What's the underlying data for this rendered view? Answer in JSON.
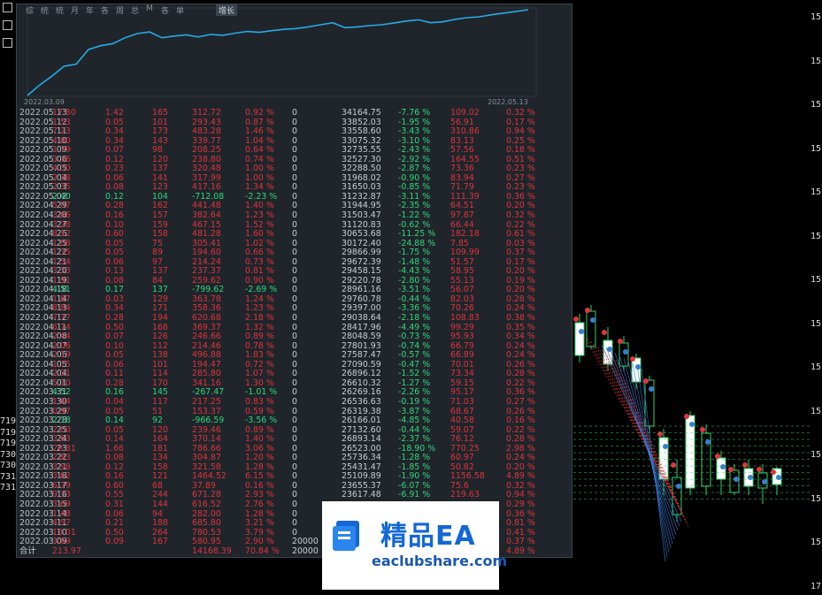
{
  "panel": {
    "tabs": [
      "综",
      "统",
      "统",
      "月",
      "年",
      "各",
      "周",
      "总",
      "M",
      "各",
      "单",
      "增长"
    ],
    "active_tab": "增长",
    "equity_start_label": "2022.03.09",
    "equity_end_label": "2022.05.13",
    "equity_curve": [
      0,
      2.5,
      4.6,
      7,
      7.5,
      11,
      11.9,
      12.4,
      13.8,
      14.8,
      15.2,
      13.8,
      14.2,
      14.5,
      14,
      14.6,
      14.4,
      14.9,
      15.3,
      15.1,
      15.5,
      15.8,
      16,
      16.4,
      16.9,
      17.4,
      16.2,
      16.4,
      16.7,
      16.9,
      17.3,
      17.8,
      18.1,
      17.4,
      17.6,
      18.2,
      18.6,
      18.8,
      19.3,
      19.7,
      20.1,
      20.5
    ],
    "rows": [
      [
        "2022.05.13",
        "17.80",
        "1.42",
        "165",
        "312.72",
        "0.92 %",
        "0",
        "34164.75",
        "-7.76 %",
        "109.02",
        "0.32 %"
      ],
      [
        "2022.05.12",
        "1.53",
        "0.05",
        "101",
        "293.43",
        "0.87 %",
        "0",
        "33852.03",
        "-1.95 %",
        "56.91",
        "0.17 %"
      ],
      [
        "2022.05.11",
        "7.23",
        "0.34",
        "173",
        "483.28",
        "1.46 %",
        "0",
        "33558.60",
        "-3.43 %",
        "310.86",
        "0.94 %"
      ],
      [
        "2022.05.10",
        "4.80",
        "0.34",
        "143",
        "339.77",
        "1.04 %",
        "0",
        "33075.32",
        "-3.10 %",
        "83.13",
        "0.25 %"
      ],
      [
        "2022.05.09",
        "1.79",
        "0.07",
        "98",
        "208.25",
        "0.64 %",
        "0",
        "32735.55",
        "-2.43 %",
        "57.56",
        "0.18 %"
      ],
      [
        "2022.05.06",
        "3.36",
        "0.12",
        "120",
        "238.80",
        "0.74 %",
        "0",
        "32527.30",
        "-2.92 %",
        "164.55",
        "0.51 %"
      ],
      [
        "2022.05.05",
        "4.30",
        "0.23",
        "137",
        "320.48",
        "1.00 %",
        "0",
        "32288.50",
        "-2.87 %",
        "73.36",
        "0.23 %"
      ],
      [
        "2022.05.04",
        "2.38",
        "0.06",
        "141",
        "317.99",
        "1.00 %",
        "0",
        "31968.02",
        "-0.90 %",
        "83.94",
        "0.27 %"
      ],
      [
        "2022.05.03",
        "2.35",
        "0.08",
        "123",
        "417.16",
        "1.34 %",
        "0",
        "31650.03",
        "-0.85 %",
        "71.79",
        "0.23 %"
      ],
      [
        "2022.05.02",
        "2.40",
        "0.12",
        "104",
        "-712.08",
        "-2.23 %",
        "0",
        "31232.87",
        "-3.11 %",
        "111.39",
        "0.36 %"
      ],
      [
        "2022.04.29",
        "5.07",
        "0.28",
        "162",
        "441.48",
        "1.40 %",
        "0",
        "31944.95",
        "-2.35 %",
        "64.51",
        "0.20 %"
      ],
      [
        "2022.04.28",
        "3.66",
        "0.16",
        "157",
        "382.64",
        "1.23 %",
        "0",
        "31503.47",
        "-1.22 %",
        "97.87",
        "0.32 %"
      ],
      [
        "2022.04.27",
        "3.28",
        "0.10",
        "159",
        "467.15",
        "1.52 %",
        "0",
        "31120.83",
        "-0.62 %",
        "66.44",
        "0.22 %"
      ],
      [
        "2022.04.26",
        "8.12",
        "0.60",
        "158",
        "481.28",
        "1.60 %",
        "0",
        "30653.68",
        "-11.25 %",
        "182.18",
        "0.61 %"
      ],
      [
        "2022.04.25",
        "1.08",
        "0.05",
        "75",
        "305.41",
        "1.02 %",
        "0",
        "30172.40",
        "-24.88 %",
        "7.85",
        "0.03 %"
      ],
      [
        "2022.04.22",
        "1.35",
        "0.05",
        "89",
        "194.60",
        "0.66 %",
        "0",
        "29866.99",
        "-1.75 %",
        "109.99",
        "0.37 %"
      ],
      [
        "2022.04.21",
        "1.54",
        "0.06",
        "97",
        "214.24",
        "0.73 %",
        "0",
        "29672.39",
        "-1.48 %",
        "51.57",
        "0.17 %"
      ],
      [
        "2022.04.20",
        "3.33",
        "0.13",
        "137",
        "237.37",
        "0.81 %",
        "0",
        "29458.15",
        "-4.43 %",
        "58.95",
        "0.20 %"
      ],
      [
        "2022.04.19",
        "1.91",
        "0.08",
        "84",
        "259.62",
        "0.90 %",
        "0",
        "29220.78",
        "-2.80 %",
        "55.13",
        "0.19 %"
      ],
      [
        "2022.04.18",
        "4.51",
        "0.17",
        "137",
        "-799.62",
        "-2.69 %",
        "0",
        "28961.16",
        "-3.51 %",
        "56.07",
        "0.20 %"
      ],
      [
        "2022.04.14",
        "1.87",
        "0.03",
        "129",
        "363.78",
        "1.24 %",
        "0",
        "29760.78",
        "-0.44 %",
        "82.03",
        "0.28 %"
      ],
      [
        "2022.04.13",
        "8.84",
        "0.34",
        "171",
        "358.36",
        "1.23 %",
        "0",
        "29397.00",
        "-3.36 %",
        "70.26",
        "0.24 %"
      ],
      [
        "2022.04.12",
        "7.77",
        "0.28",
        "194",
        "620.68",
        "2.18 %",
        "0",
        "29038.64",
        "-2.18 %",
        "108.83",
        "0.38 %"
      ],
      [
        "2022.04.11",
        "6.74",
        "0.50",
        "168",
        "369.37",
        "1.32 %",
        "0",
        "28417.96",
        "-4.49 %",
        "99.29",
        "0.35 %"
      ],
      [
        "2022.04.08",
        "2.44",
        "0.07",
        "126",
        "246.66",
        "0.89 %",
        "0",
        "28048.59",
        "-0.73 %",
        "95.93",
        "0.34 %"
      ],
      [
        "2022.04.07",
        "2.06",
        "0.10",
        "112",
        "214.46",
        "0.78 %",
        "0",
        "27801.93",
        "-0.74 %",
        "66.79",
        "0.24 %"
      ],
      [
        "2022.04.06",
        "2.19",
        "0.05",
        "138",
        "496.88",
        "1.83 %",
        "0",
        "27587.47",
        "-0.57 %",
        "66.89",
        "0.24 %"
      ],
      [
        "2022.04.05",
        "1.75",
        "0.06",
        "101",
        "194.47",
        "0.72 %",
        "0",
        "27090.59",
        "-0.47 %",
        "70.01",
        "0.26 %"
      ],
      [
        "2022.04.04",
        "2.31",
        "0.11",
        "114",
        "285.80",
        "1.07 %",
        "0",
        "26896.12",
        "-1.52 %",
        "73.34",
        "0.28 %"
      ],
      [
        "2022.04.01",
        "5.10",
        "0.28",
        "170",
        "341.16",
        "1.30 %",
        "0",
        "26610.32",
        "-1.27 %",
        "59.15",
        "0.22 %"
      ],
      [
        "2022.03.31",
        "4.52",
        "0.16",
        "145",
        "-267.47",
        "-1.01 %",
        "0",
        "26269.16",
        "-2.26 %",
        "95.17",
        "0.36 %"
      ],
      [
        "2022.03.30",
        "1.64",
        "0.04",
        "117",
        "217.25",
        "0.83 %",
        "0",
        "26536.63",
        "-0.19 %",
        "71.03",
        "0.27 %"
      ],
      [
        "2022.03.29",
        "0.97",
        "0.05",
        "51",
        "153.37",
        "0.59 %",
        "0",
        "26319.38",
        "-3.87 %",
        "68.67",
        "0.26 %"
      ],
      [
        "2022.03.28",
        "2.18",
        "0.14",
        "92",
        "-966.59",
        "-3.56 %",
        "0",
        "26166.01",
        "-4.85 %",
        "40.58",
        "0.16 %"
      ],
      [
        "2022.03.25",
        "2.00",
        "0.05",
        "120",
        "239.46",
        "0.89 %",
        "0",
        "27132.60",
        "-0.44 %",
        "59.07",
        "0.22 %"
      ],
      [
        "2022.03.24",
        "3.63",
        "0.14",
        "164",
        "370.14",
        "1.40 %",
        "0",
        "26893.14",
        "-2.37 %",
        "76.12",
        "0.28 %"
      ],
      [
        "2022.03.23",
        "20.81",
        "1.66",
        "181",
        "786.66",
        "3.06 %",
        "0",
        "26523.00",
        "-18.90 %",
        "770.25",
        "2.98 %"
      ],
      [
        "2022.03.22",
        "2.83",
        "0.08",
        "134",
        "304.87",
        "1.20 %",
        "0",
        "25736.34",
        "-1.28 %",
        "60.97",
        "0.24 %"
      ],
      [
        "2022.03.21",
        "3.98",
        "0.12",
        "158",
        "321.58",
        "1.28 %",
        "0",
        "25431.47",
        "-1.85 %",
        "50.82",
        "0.20 %"
      ],
      [
        "2022.03.18",
        "3.62",
        "0.16",
        "121",
        "1464.52",
        "6.15 %",
        "0",
        "25109.89",
        "-1.90 %",
        "1156.58",
        "4.89 %"
      ],
      [
        "2022.03.17",
        "6.79",
        "0.60",
        "68",
        "37.89",
        "0.16 %",
        "0",
        "23655.37",
        "-6.07 %",
        "75.6",
        "0.32 %"
      ],
      [
        "2022.03.16",
        "9.33",
        "0.55",
        "244",
        "671.28",
        "2.93 %",
        "0",
        "23617.48",
        "-6.91 %",
        "219.63",
        "0.94 %"
      ],
      [
        "2022.03.15",
        "3.69",
        "0.31",
        "144",
        "616.52",
        "2.76 %",
        "0",
        "",
        "",
        "",
        "0.29 %"
      ],
      [
        "2022.03.14",
        "1.48",
        "0.06",
        "94",
        "282.00",
        "1.28 %",
        "0",
        "",
        "",
        "",
        "0.36 %"
      ],
      [
        "2022.03.11",
        "4.97",
        "0.21",
        "188",
        "685.80",
        "3.21 %",
        "0",
        "",
        "",
        "",
        "0.81 %"
      ],
      [
        "2022.03.10",
        "10.01",
        "0.50",
        "264",
        "780.53",
        "3.79 %",
        "0",
        "",
        "",
        "",
        "0.41 %"
      ],
      [
        "2022.03.09",
        "3.69",
        "0.09",
        "167",
        "580.95",
        "2.90 %",
        "20000",
        "",
        "",
        "",
        "0.37 %"
      ]
    ],
    "total": [
      "合计",
      "213.97",
      "",
      "",
      "14168.39",
      "70.84 %",
      "20000",
      "",
      "",
      "",
      "4.89 %"
    ]
  },
  "price_axis": [
    "15",
    "15",
    "15",
    "15",
    "15",
    "15",
    "15",
    "15",
    "15",
    "15",
    "15",
    "15",
    "15",
    "17"
  ],
  "left_price_labels": [
    "719",
    "719",
    "719",
    "730",
    "730",
    "731",
    "731"
  ],
  "watermark": {
    "cn": "精品EA",
    "url": "eaclubshare.com"
  },
  "colors": {
    "up": "#33d67a",
    "down": "#e0343b",
    "equity": "#29a9e6",
    "panel_bg": "#1f252b"
  }
}
